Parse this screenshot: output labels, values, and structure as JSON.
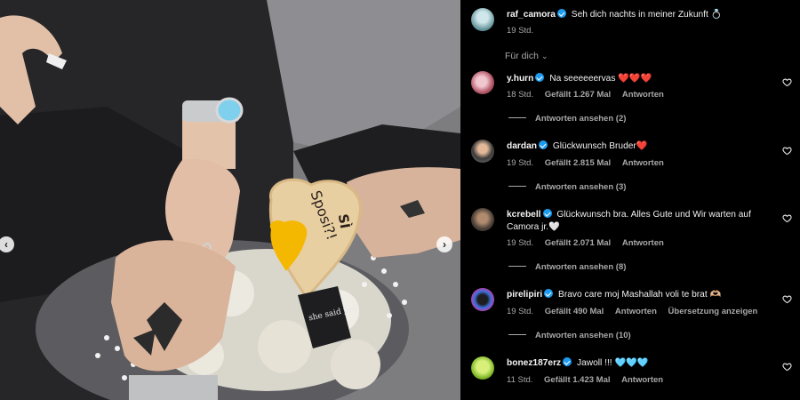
{
  "post": {
    "author": "raf_camora",
    "caption": "Seh dich nachts in meiner Zukunft 💍",
    "time": "19 Std."
  },
  "photo": {
    "cookie_text": "Sposi?!",
    "cookie_text2": "SÌ",
    "tag_text": "she said yes"
  },
  "filter": {
    "label": "Für dich"
  },
  "labels": {
    "reply": "Antworten",
    "see_translation": "Übersetzung anzeigen"
  },
  "comments": [
    {
      "user": "y.hurn",
      "text": "Na seeeeeervas ❤️❤️❤️",
      "time": "18 Std.",
      "likes": "Gefällt 1.267 Mal",
      "replies": "Antworten ansehen (2)"
    },
    {
      "user": "dardan",
      "text": "Glückwunsch Bruder❤️",
      "time": "19 Std.",
      "likes": "Gefällt 2.815 Mal",
      "replies": "Antworten ansehen (3)"
    },
    {
      "user": "kcrebell",
      "text": "Glückwunsch bra. Alles Gute und Wir warten auf",
      "text2": "Camora jr.🤍",
      "time": "19 Std.",
      "likes": "Gefällt 2.071 Mal",
      "replies": "Antworten ansehen (8)"
    },
    {
      "user": "pirelipiri",
      "text": "Bravo care moj Mashallah voli te brat 🫶🏼",
      "time": "19 Std.",
      "likes": "Gefällt 490 Mal",
      "replies": "Antworten ansehen (10)"
    },
    {
      "user": "bonez187erz",
      "text": "Jawoll !!! 🩵🩵🩵",
      "time": "11 Std.",
      "likes": "Gefällt 1.423 Mal"
    }
  ],
  "icons": {
    "prev": "chevron-left-icon",
    "next": "chevron-right-icon",
    "like": "heart-outline-icon",
    "verified": "verified-badge-icon"
  },
  "colors": {
    "background": "#000000",
    "verified": "#1d9bf0",
    "muted": "#a8a8a8"
  }
}
